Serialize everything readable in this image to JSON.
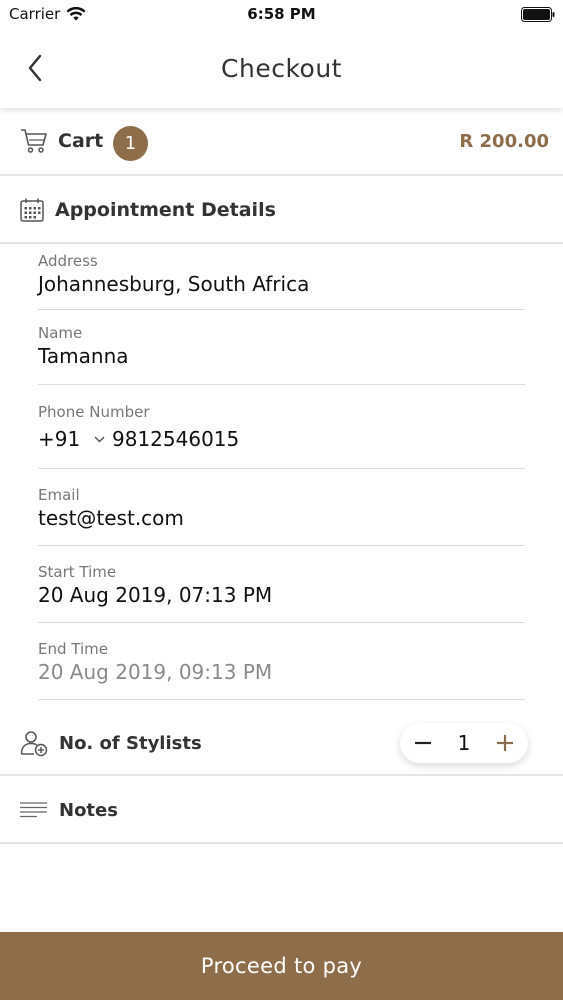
{
  "status_bar": {
    "carrier": "Carrier",
    "time": "6:58 PM",
    "wifi_icon": "wifi-icon",
    "battery_icon": "battery-icon"
  },
  "nav": {
    "title": "Checkout",
    "back_icon": "chevron-left-icon"
  },
  "cart": {
    "label": "Cart",
    "count": "1",
    "total": "R 200.00",
    "icon": "cart-icon"
  },
  "appointment": {
    "header": "Appointment Details",
    "icon": "calendar-icon",
    "address": {
      "label": "Address",
      "value": "Johannesburg, South Africa"
    },
    "name": {
      "label": "Name",
      "value": "Tamanna"
    },
    "phone": {
      "label": "Phone Number",
      "code": "+91",
      "number": "9812546015"
    },
    "email": {
      "label": "Email",
      "value": "test@test.com"
    },
    "start_time": {
      "label": "Start Time",
      "value": "20 Aug 2019, 07:13 PM"
    },
    "end_time": {
      "label": "End Time",
      "value": "20 Aug 2019, 09:13 PM"
    }
  },
  "stylists": {
    "label": "No. of Stylists",
    "icon": "add-user-icon",
    "count": "1"
  },
  "notes": {
    "label": "Notes",
    "icon": "notes-icon"
  },
  "pay_button": {
    "label": "Proceed to pay"
  },
  "colors": {
    "accent": "#8e6e4a",
    "divider": "#e4e4e4"
  }
}
